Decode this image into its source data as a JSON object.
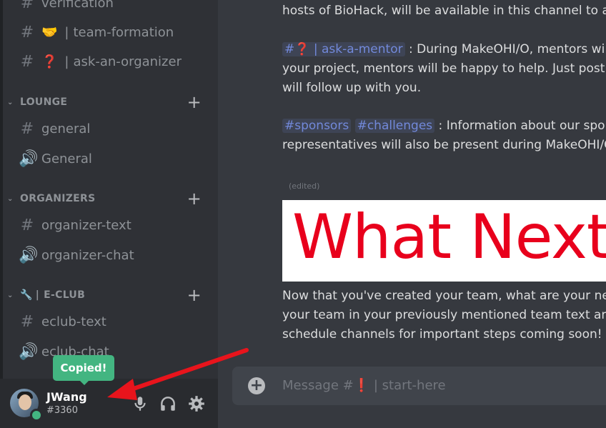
{
  "sidebar": {
    "channels_top": [
      {
        "label": "verification",
        "type": "text"
      },
      {
        "label": "team-formation",
        "emoji": "🤝",
        "type": "text"
      },
      {
        "label": "ask-an-organizer",
        "emoji": "❓",
        "type": "text"
      }
    ],
    "categories": [
      {
        "name": "LOUNGE",
        "channels": [
          {
            "label": "general",
            "type": "text"
          },
          {
            "label": "General",
            "type": "voice"
          }
        ]
      },
      {
        "name": "ORGANIZERS",
        "channels": [
          {
            "label": "organizer-text",
            "type": "text"
          },
          {
            "label": "organizer-chat",
            "type": "voice"
          }
        ]
      },
      {
        "name": "E-CLUB",
        "emoji": "🔧",
        "channels": [
          {
            "label": "eclub-text",
            "type": "text"
          },
          {
            "label": "eclub-chat",
            "type": "voice"
          }
        ]
      }
    ]
  },
  "user": {
    "name": "JWang",
    "tag": "#3360",
    "status_color": "#43b581"
  },
  "tooltip": {
    "text": "Copied!"
  },
  "message": {
    "line1": "hosts of BioHack, will be available in this channel to ans",
    "mention_ask": "#❓ | ask-a-mentor",
    "line2_rest": " : During MakeOHI/O, mentors wi",
    "line3": "your project, mentors will be happy to help. Just post yo",
    "line4": "will follow up with you.",
    "mention_sponsors": "#sponsors",
    "mention_challenges": "#challenges",
    "line5_rest": " : Information about our spons",
    "line6": "representatives will also be present during MakeOHI/O",
    "edited": "(edited)",
    "banner": "What Next?",
    "line7": "Now that you've created your team, what are your next",
    "line8": "your team in your previously mentioned team text and",
    "line9": "schedule channels for important steps coming soon!"
  },
  "composer": {
    "placeholder_prefix": "Message #",
    "placeholder_emoji": "❗",
    "placeholder_suffix": " | start-here"
  },
  "colors": {
    "accent": "#7289da",
    "arrow": "#e8141c",
    "banner_text": "#e8001c"
  }
}
